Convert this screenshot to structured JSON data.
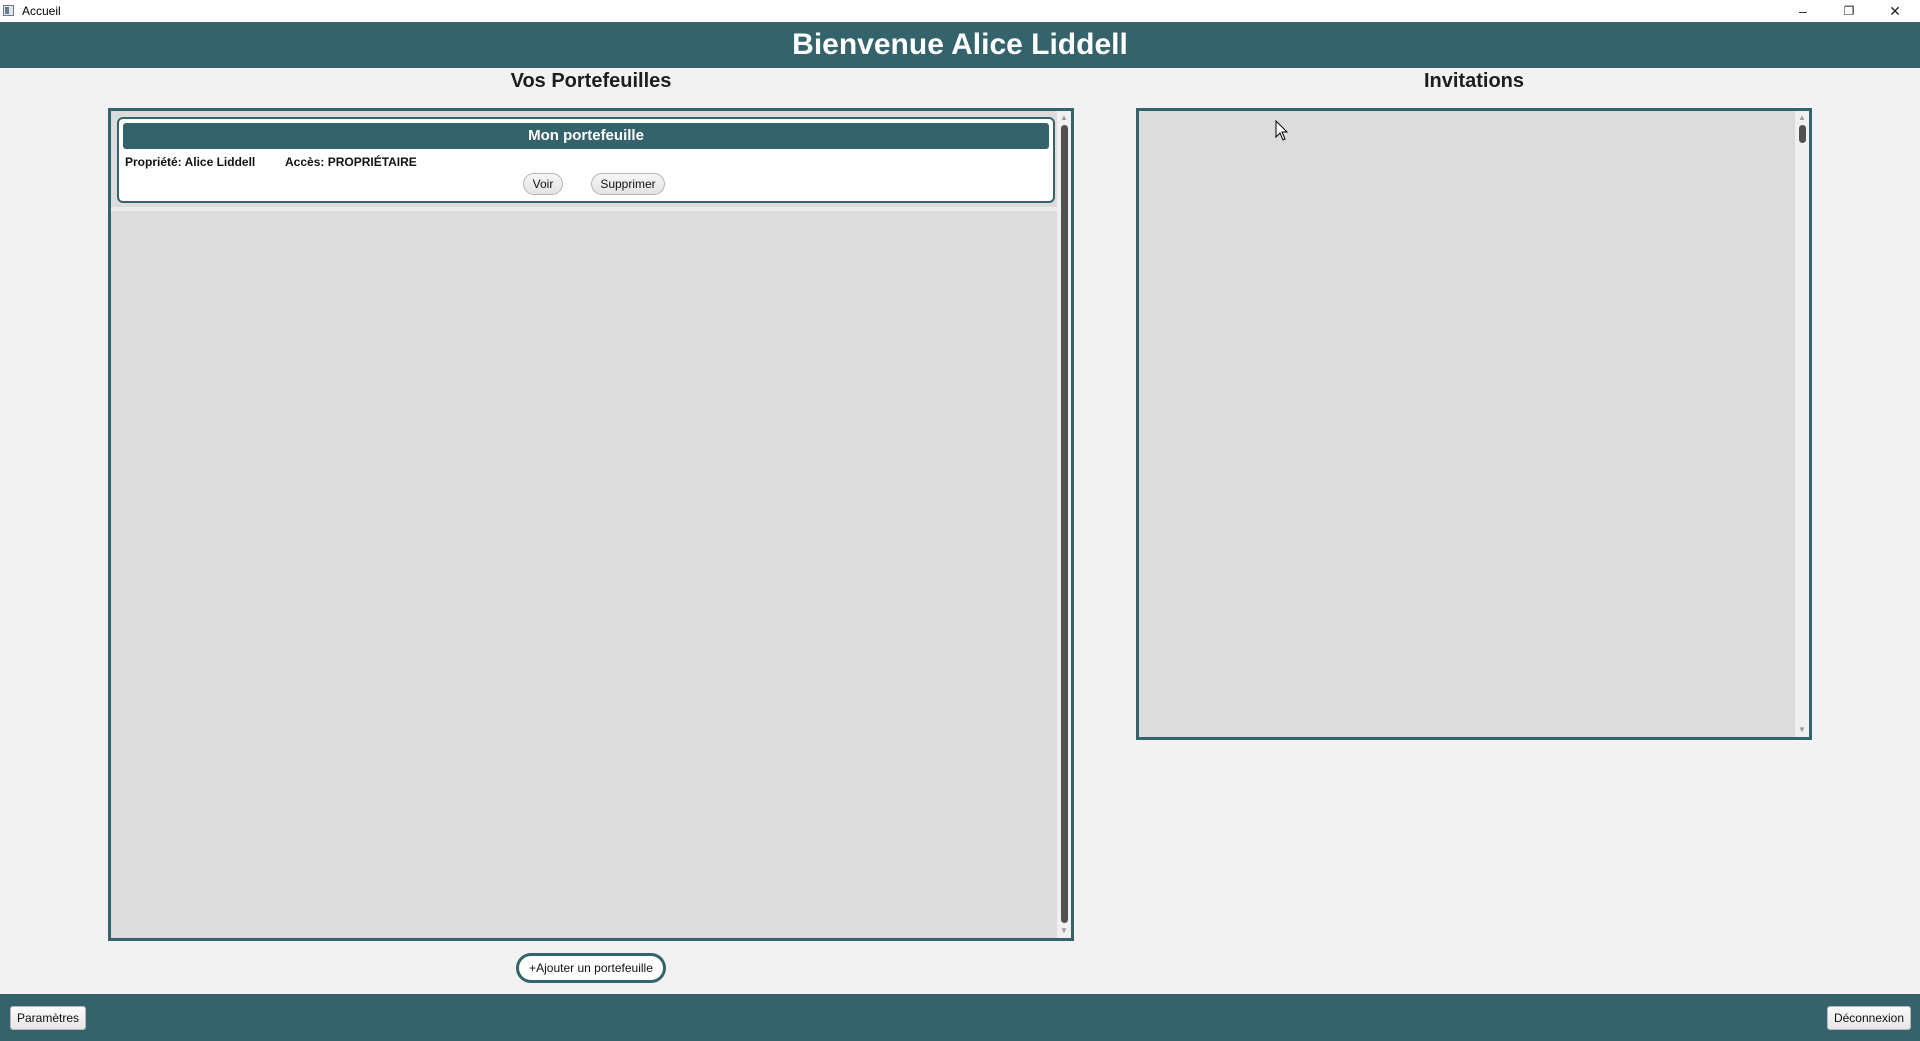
{
  "window": {
    "title": "Accueil",
    "minimize_glyph": "–",
    "restore_glyph": "❐",
    "close_glyph": "✕"
  },
  "header": {
    "welcome": "Bienvenue Alice Liddell"
  },
  "portfolios": {
    "section_title": "Vos Portefeuilles",
    "cards": [
      {
        "name": "Mon portefeuille",
        "owner": "Propriété: Alice Liddell",
        "access": "Accès: PROPRIÉTAIRE",
        "view_label": "Voir",
        "delete_label": "Supprimer"
      }
    ],
    "add_label": "+Ajouter un portefeuille"
  },
  "invitations": {
    "section_title": "Invitations"
  },
  "footer": {
    "settings_label": "Paramètres",
    "logout_label": "Déconnexion"
  },
  "colors": {
    "accent": "#35636c",
    "panel_bg": "#dcdcdc",
    "page_bg": "#f2f2f2"
  },
  "icons": [
    "app-icon",
    "minimize-icon",
    "restore-icon",
    "close-icon",
    "mouse-cursor-icon"
  ]
}
